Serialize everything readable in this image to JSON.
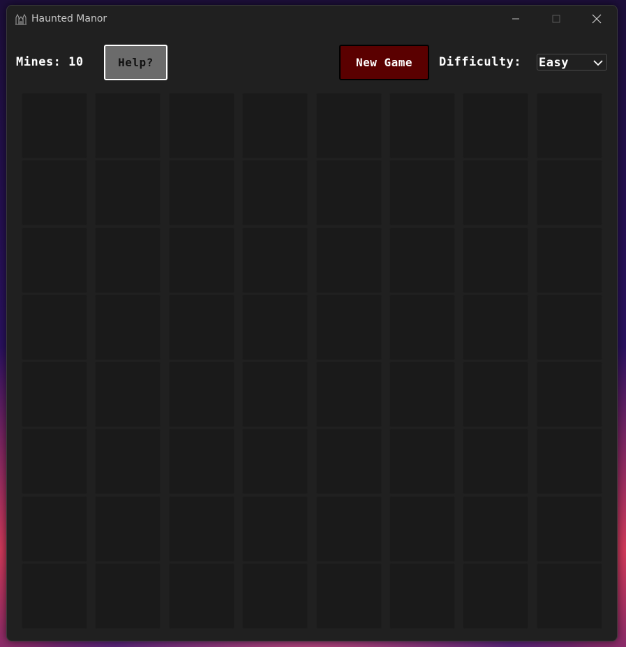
{
  "window": {
    "title": "Haunted Manor",
    "icon": "haunted-manor-icon",
    "controls": [
      "minimize-icon",
      "maximize-icon",
      "close-icon"
    ]
  },
  "toolbar": {
    "mines_label": "Mines: 10",
    "help_label": "Help?",
    "new_game_label": "New Game",
    "difficulty_label": "Difficulty:",
    "difficulty_value": "Easy"
  },
  "board": {
    "rows": 8,
    "cols": 8,
    "state": "all-hidden"
  },
  "colors": {
    "window_bg": "#202020",
    "cell_bg": "#1a1a1a",
    "help_bg": "#6b6b6b",
    "new_game_bg": "#5a0000",
    "text": "#ffffff"
  }
}
